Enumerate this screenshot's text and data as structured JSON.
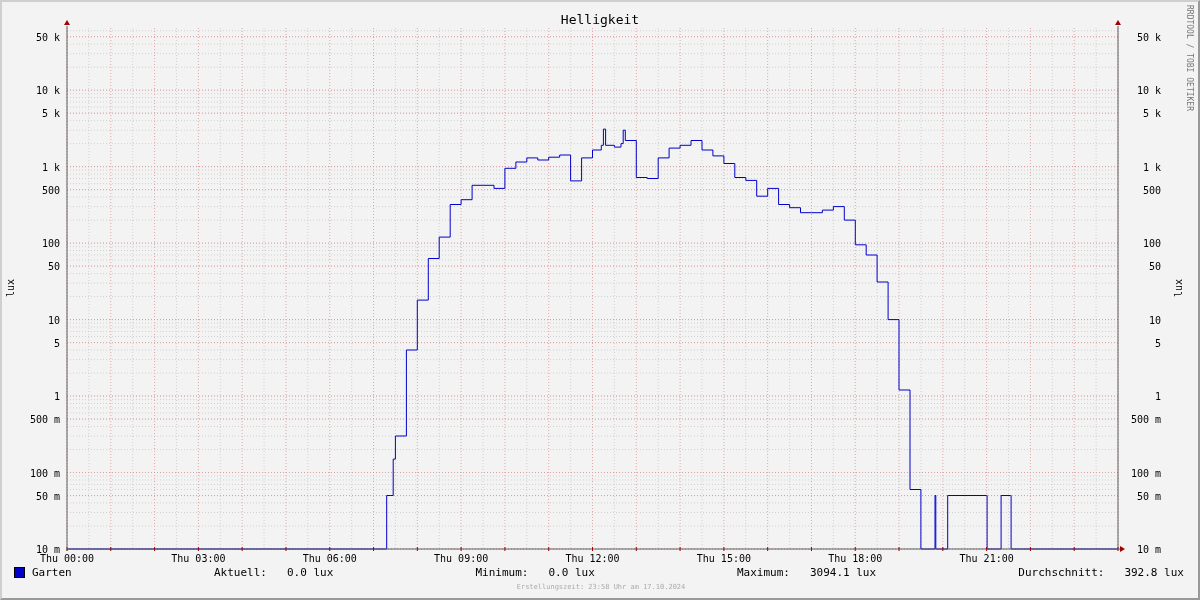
{
  "chart": {
    "title": "Helligkeit",
    "ylabel": "lux",
    "xtick_labels": [
      "Thu 00:00",
      "Thu 03:00",
      "Thu 06:00",
      "Thu 09:00",
      "Thu 12:00",
      "Thu 15:00",
      "Thu 18:00",
      "Thu 21:00"
    ],
    "ytick_labels": [
      "50 k",
      "10 k",
      "5 k",
      "1 k",
      "500",
      "100",
      "50",
      "10",
      "5",
      "1",
      "500 m",
      "100 m",
      "50 m",
      "10 m"
    ],
    "right_axis": {
      "ylabel": "lux",
      "ticks": [
        "50 k",
        "10 k",
        "5 k",
        "1 k",
        "500",
        "100",
        "50",
        "10",
        "5",
        "1",
        "500 m",
        "100 m",
        "50 m",
        "10 m"
      ]
    },
    "credit": "RRDTOOL / TOBI OETIKER"
  },
  "legend": {
    "series": [
      {
        "name": "Garten",
        "color": "#0000cc"
      }
    ],
    "stats": [
      {
        "label": "Aktuell:",
        "value": "0.0 lux"
      },
      {
        "label": "Minimum:",
        "value": "0.0 lux"
      },
      {
        "label": "Maximum:",
        "value": "3094.1 lux"
      },
      {
        "label": "Durchschnitt:",
        "value": "392.8 lux"
      }
    ]
  },
  "footer": "Erstellungszeit: 23:58 Uhr am 17.10.2024"
}
